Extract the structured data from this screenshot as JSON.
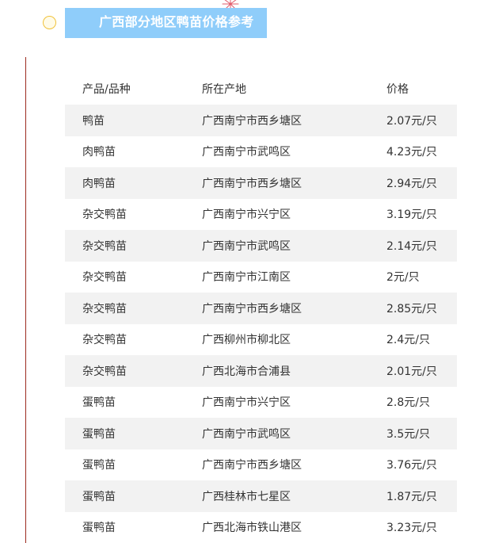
{
  "title": "广西部分地区鸭苗价格参考",
  "table": {
    "headers": [
      "产品/品种",
      "所在产地",
      "价格"
    ],
    "rows": [
      [
        "鸭苗",
        "广西南宁市西乡塘区",
        "2.07元/只"
      ],
      [
        "肉鸭苗",
        "广西南宁市武鸣区",
        "4.23元/只"
      ],
      [
        "肉鸭苗",
        "广西南宁市西乡塘区",
        "2.94元/只"
      ],
      [
        "杂交鸭苗",
        "广西南宁市兴宁区",
        "3.19元/只"
      ],
      [
        "杂交鸭苗",
        "广西南宁市武鸣区",
        "2.14元/只"
      ],
      [
        "杂交鸭苗",
        "广西南宁市江南区",
        "2元/只"
      ],
      [
        "杂交鸭苗",
        "广西南宁市西乡塘区",
        "2.85元/只"
      ],
      [
        "杂交鸭苗",
        "广西柳州市柳北区",
        "2.4元/只"
      ],
      [
        "杂交鸭苗",
        "广西北海市合浦县",
        "2.01元/只"
      ],
      [
        "蛋鸭苗",
        "广西南宁市兴宁区",
        "2.8元/只"
      ],
      [
        "蛋鸭苗",
        "广西南宁市武鸣区",
        "3.5元/只"
      ],
      [
        "蛋鸭苗",
        "广西南宁市西乡塘区",
        "3.76元/只"
      ],
      [
        "蛋鸭苗",
        "广西桂林市七星区",
        "1.87元/只"
      ],
      [
        "蛋鸭苗",
        "广西北海市铁山港区",
        "3.23元/只"
      ]
    ]
  },
  "colors": {
    "banner": "#8fcdfa",
    "row_shade": "#f2f2f2",
    "accent_line": "#9c2a1f",
    "circle": "#f0c23a"
  },
  "icons": {
    "circle": "circle-icon",
    "sparkle": "sparkle-icon"
  }
}
